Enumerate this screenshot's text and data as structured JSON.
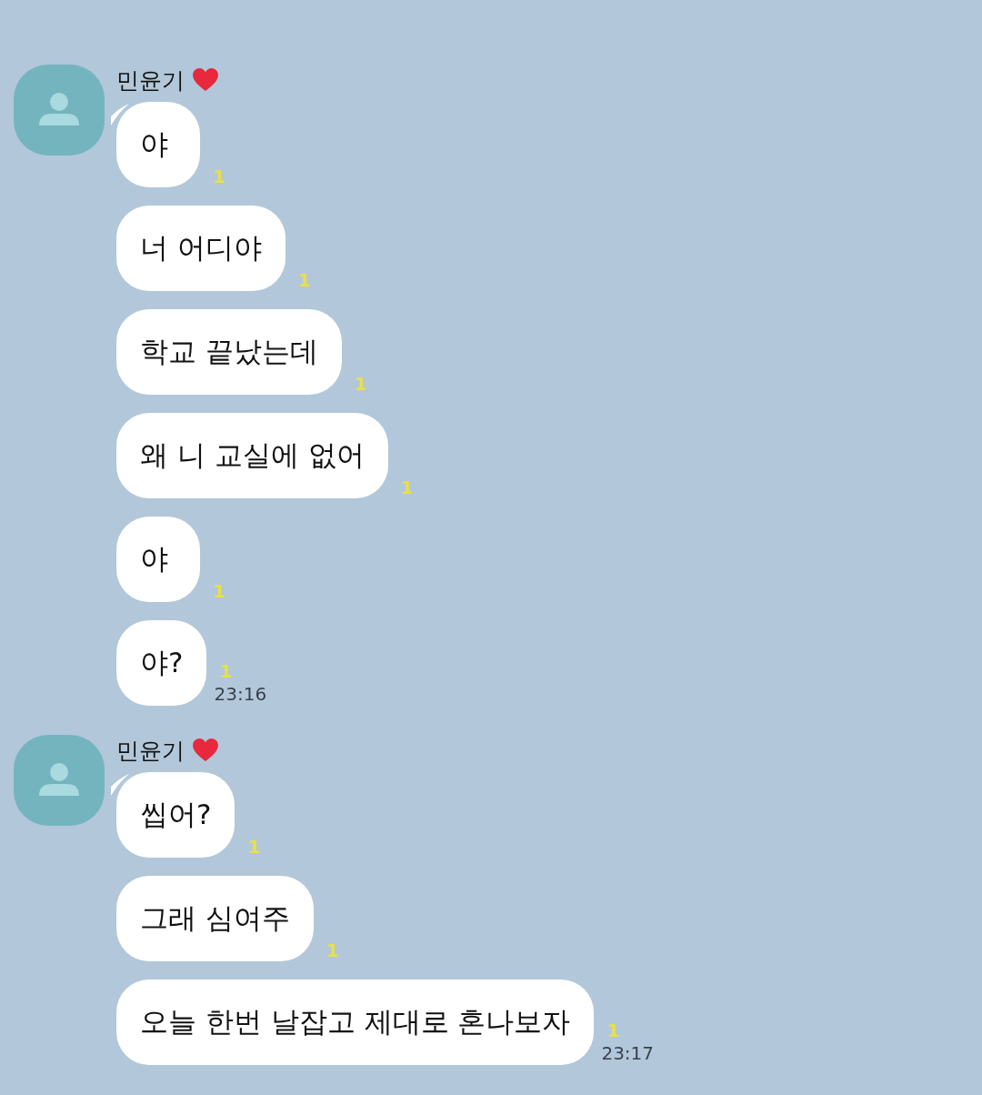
{
  "groups": [
    {
      "sender": "민윤기",
      "messages": [
        {
          "text": "야",
          "unread": "1"
        },
        {
          "text": "너 어디야",
          "unread": "1"
        },
        {
          "text": "학교 끝났는데",
          "unread": "1"
        },
        {
          "text": "왜 니 교실에 없어",
          "unread": "1"
        },
        {
          "text": "야",
          "unread": "1"
        },
        {
          "text": "야?",
          "unread": "1",
          "time": "23:16"
        }
      ]
    },
    {
      "sender": "민윤기",
      "messages": [
        {
          "text": "씹어?",
          "unread": "1"
        },
        {
          "text": "그래 심여주",
          "unread": "1"
        },
        {
          "text": "오늘 한번 날잡고 제대로 혼나보자",
          "unread": "1",
          "time": "23:17"
        }
      ]
    }
  ]
}
